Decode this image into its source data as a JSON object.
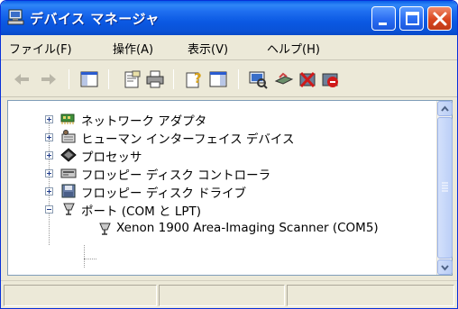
{
  "window": {
    "title": "デバイス マネージャ"
  },
  "menubar": {
    "items": [
      {
        "label": "ファイル(F)"
      },
      {
        "label": "操作(A)"
      },
      {
        "label": "表示(V)"
      },
      {
        "label": "ヘルプ(H)"
      }
    ]
  },
  "tree": {
    "items": [
      {
        "label": "ネットワーク アダプタ",
        "icon": "network-adapter-icon"
      },
      {
        "label": "ヒューマン インターフェイス デバイス",
        "icon": "hid-icon"
      },
      {
        "label": "プロセッサ",
        "icon": "processor-icon"
      },
      {
        "label": "フロッピー ディスク コントローラ",
        "icon": "floppy-controller-icon"
      },
      {
        "label": "フロッピー ディスク ドライブ",
        "icon": "floppy-drive-icon"
      },
      {
        "label": "ポート (COM と LPT)",
        "icon": "port-icon"
      },
      {
        "label": "Xenon 1900 Area-Imaging Scanner (COM5)",
        "icon": "port-device-icon"
      }
    ]
  },
  "colors": {
    "titlebar": "#0a53d8",
    "close_button": "#d9461f",
    "window_face": "#ece9d8"
  }
}
